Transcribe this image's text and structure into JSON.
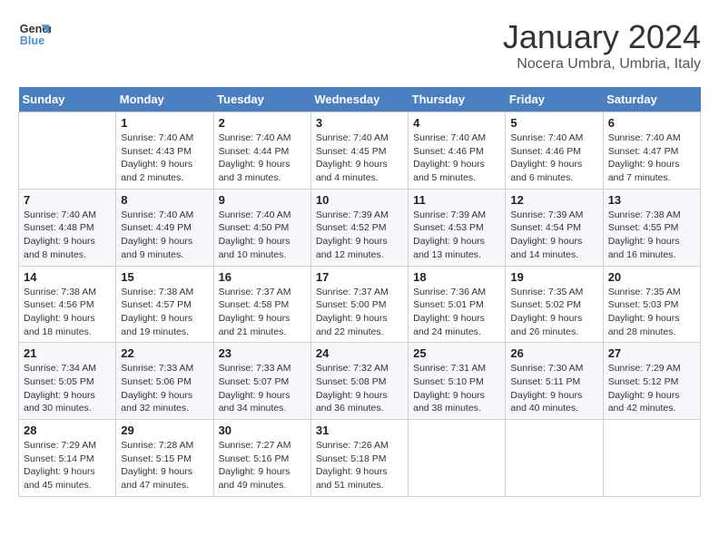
{
  "logo": {
    "line1": "General",
    "line2": "Blue"
  },
  "title": "January 2024",
  "subtitle": "Nocera Umbra, Umbria, Italy",
  "weekdays": [
    "Sunday",
    "Monday",
    "Tuesday",
    "Wednesday",
    "Thursday",
    "Friday",
    "Saturday"
  ],
  "weeks": [
    [
      {
        "day": "",
        "info": ""
      },
      {
        "day": "1",
        "info": "Sunrise: 7:40 AM\nSunset: 4:43 PM\nDaylight: 9 hours\nand 2 minutes."
      },
      {
        "day": "2",
        "info": "Sunrise: 7:40 AM\nSunset: 4:44 PM\nDaylight: 9 hours\nand 3 minutes."
      },
      {
        "day": "3",
        "info": "Sunrise: 7:40 AM\nSunset: 4:45 PM\nDaylight: 9 hours\nand 4 minutes."
      },
      {
        "day": "4",
        "info": "Sunrise: 7:40 AM\nSunset: 4:46 PM\nDaylight: 9 hours\nand 5 minutes."
      },
      {
        "day": "5",
        "info": "Sunrise: 7:40 AM\nSunset: 4:46 PM\nDaylight: 9 hours\nand 6 minutes."
      },
      {
        "day": "6",
        "info": "Sunrise: 7:40 AM\nSunset: 4:47 PM\nDaylight: 9 hours\nand 7 minutes."
      }
    ],
    [
      {
        "day": "7",
        "info": "Sunrise: 7:40 AM\nSunset: 4:48 PM\nDaylight: 9 hours\nand 8 minutes."
      },
      {
        "day": "8",
        "info": "Sunrise: 7:40 AM\nSunset: 4:49 PM\nDaylight: 9 hours\nand 9 minutes."
      },
      {
        "day": "9",
        "info": "Sunrise: 7:40 AM\nSunset: 4:50 PM\nDaylight: 9 hours\nand 10 minutes."
      },
      {
        "day": "10",
        "info": "Sunrise: 7:39 AM\nSunset: 4:52 PM\nDaylight: 9 hours\nand 12 minutes."
      },
      {
        "day": "11",
        "info": "Sunrise: 7:39 AM\nSunset: 4:53 PM\nDaylight: 9 hours\nand 13 minutes."
      },
      {
        "day": "12",
        "info": "Sunrise: 7:39 AM\nSunset: 4:54 PM\nDaylight: 9 hours\nand 14 minutes."
      },
      {
        "day": "13",
        "info": "Sunrise: 7:38 AM\nSunset: 4:55 PM\nDaylight: 9 hours\nand 16 minutes."
      }
    ],
    [
      {
        "day": "14",
        "info": "Sunrise: 7:38 AM\nSunset: 4:56 PM\nDaylight: 9 hours\nand 18 minutes."
      },
      {
        "day": "15",
        "info": "Sunrise: 7:38 AM\nSunset: 4:57 PM\nDaylight: 9 hours\nand 19 minutes."
      },
      {
        "day": "16",
        "info": "Sunrise: 7:37 AM\nSunset: 4:58 PM\nDaylight: 9 hours\nand 21 minutes."
      },
      {
        "day": "17",
        "info": "Sunrise: 7:37 AM\nSunset: 5:00 PM\nDaylight: 9 hours\nand 22 minutes."
      },
      {
        "day": "18",
        "info": "Sunrise: 7:36 AM\nSunset: 5:01 PM\nDaylight: 9 hours\nand 24 minutes."
      },
      {
        "day": "19",
        "info": "Sunrise: 7:35 AM\nSunset: 5:02 PM\nDaylight: 9 hours\nand 26 minutes."
      },
      {
        "day": "20",
        "info": "Sunrise: 7:35 AM\nSunset: 5:03 PM\nDaylight: 9 hours\nand 28 minutes."
      }
    ],
    [
      {
        "day": "21",
        "info": "Sunrise: 7:34 AM\nSunset: 5:05 PM\nDaylight: 9 hours\nand 30 minutes."
      },
      {
        "day": "22",
        "info": "Sunrise: 7:33 AM\nSunset: 5:06 PM\nDaylight: 9 hours\nand 32 minutes."
      },
      {
        "day": "23",
        "info": "Sunrise: 7:33 AM\nSunset: 5:07 PM\nDaylight: 9 hours\nand 34 minutes."
      },
      {
        "day": "24",
        "info": "Sunrise: 7:32 AM\nSunset: 5:08 PM\nDaylight: 9 hours\nand 36 minutes."
      },
      {
        "day": "25",
        "info": "Sunrise: 7:31 AM\nSunset: 5:10 PM\nDaylight: 9 hours\nand 38 minutes."
      },
      {
        "day": "26",
        "info": "Sunrise: 7:30 AM\nSunset: 5:11 PM\nDaylight: 9 hours\nand 40 minutes."
      },
      {
        "day": "27",
        "info": "Sunrise: 7:29 AM\nSunset: 5:12 PM\nDaylight: 9 hours\nand 42 minutes."
      }
    ],
    [
      {
        "day": "28",
        "info": "Sunrise: 7:29 AM\nSunset: 5:14 PM\nDaylight: 9 hours\nand 45 minutes."
      },
      {
        "day": "29",
        "info": "Sunrise: 7:28 AM\nSunset: 5:15 PM\nDaylight: 9 hours\nand 47 minutes."
      },
      {
        "day": "30",
        "info": "Sunrise: 7:27 AM\nSunset: 5:16 PM\nDaylight: 9 hours\nand 49 minutes."
      },
      {
        "day": "31",
        "info": "Sunrise: 7:26 AM\nSunset: 5:18 PM\nDaylight: 9 hours\nand 51 minutes."
      },
      {
        "day": "",
        "info": ""
      },
      {
        "day": "",
        "info": ""
      },
      {
        "day": "",
        "info": ""
      }
    ]
  ]
}
